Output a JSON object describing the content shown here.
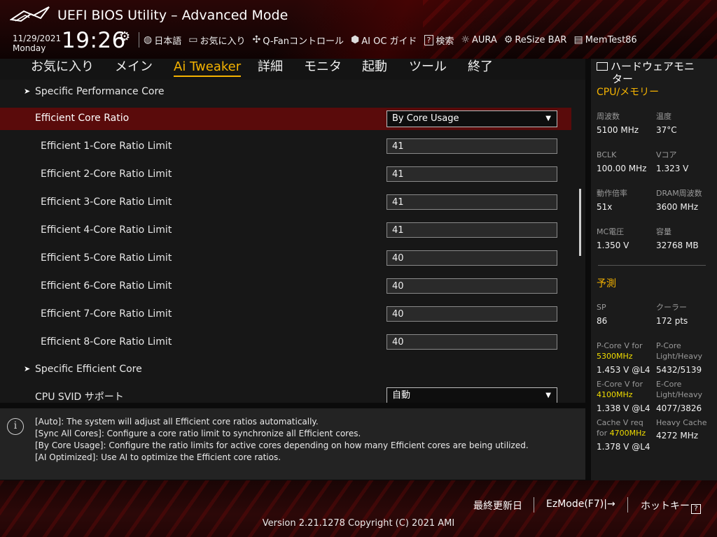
{
  "header": {
    "title": "UEFI BIOS Utility – Advanced Mode",
    "date": "11/29/2021",
    "day": "Monday",
    "time": "19:26",
    "toolbar": [
      {
        "icon": "globe-icon",
        "glyph": "🌐",
        "label": "日本語"
      },
      {
        "icon": "bookmark-icon",
        "glyph": "🗎",
        "label": "お気に入り"
      },
      {
        "icon": "fan-icon",
        "glyph": "✣",
        "label": "Q-Fanコントロール"
      },
      {
        "icon": "ai-oc-icon",
        "glyph": "⛭",
        "label": "AI OC ガイド"
      },
      {
        "icon": "help-icon",
        "glyph": "?",
        "label": "検索"
      },
      {
        "icon": "aura-icon",
        "glyph": "☼",
        "label": "AURA"
      },
      {
        "icon": "resize-bar-icon",
        "glyph": "⚙",
        "label": "ReSize BAR"
      },
      {
        "icon": "memtest-icon",
        "glyph": "▤",
        "label": "MemTest86"
      }
    ]
  },
  "nav": {
    "tabs": [
      "お気に入り",
      "メイン",
      "Ai Tweaker",
      "詳細",
      "モニタ",
      "起動",
      "ツール",
      "終了"
    ],
    "active": "Ai Tweaker"
  },
  "settings": {
    "specific_performance_core": "Specific Performance Core",
    "efficient_core_ratio": {
      "label": "Efficient Core Ratio",
      "value": "By Core Usage"
    },
    "limits": [
      {
        "label": "Efficient 1-Core Ratio Limit",
        "value": "41"
      },
      {
        "label": "Efficient 2-Core Ratio Limit",
        "value": "41"
      },
      {
        "label": "Efficient 3-Core Ratio Limit",
        "value": "41"
      },
      {
        "label": "Efficient 4-Core Ratio Limit",
        "value": "41"
      },
      {
        "label": "Efficient 5-Core Ratio Limit",
        "value": "40"
      },
      {
        "label": "Efficient 6-Core Ratio Limit",
        "value": "40"
      },
      {
        "label": "Efficient 7-Core Ratio Limit",
        "value": "40"
      },
      {
        "label": "Efficient 8-Core Ratio Limit",
        "value": "40"
      }
    ],
    "specific_efficient_core": "Specific Efficient Core",
    "cpu_svid": {
      "label": "CPU SVID サポート",
      "value": "自動"
    }
  },
  "help": {
    "lines": [
      "[Auto]: The system will adjust all Efficient core ratios automatically.",
      "[Sync All Cores]: Configure a core ratio limit to synchronize all Efficient cores.",
      "[By Core Usage]: Configure the ratio limits for active cores depending on how many Efficient cores are being utilized.",
      "[AI Optimized]: Use AI to optimize the Efficient core ratios."
    ]
  },
  "monitor": {
    "title_line1": "ハードウェアモニ",
    "title_line2": "ター",
    "section_cpu": "CPU/メモリー",
    "freq_label": "周波数",
    "freq_value": "5100 MHz",
    "temp_label": "温度",
    "temp_value": "37°C",
    "bclk_label": "BCLK",
    "bclk_value": "100.00 MHz",
    "vcore_label": "Vコア",
    "vcore_value": "1.323 V",
    "ratio_label": "動作倍率",
    "ratio_value": "51x",
    "dram_label": "DRAM周波数",
    "dram_value": "3600 MHz",
    "mc_label": "MC電圧",
    "mc_value": "1.350 V",
    "cap_label": "容量",
    "cap_value": "32768 MB",
    "section_pred": "予測",
    "sp_label": "SP",
    "sp_value": "86",
    "cooler_label": "クーラー",
    "cooler_value": "172 pts",
    "pcore_v_label": "P-Core V for",
    "pcore_v_freq": "5300MHz",
    "pcore_v_value": "1.453 V @L4",
    "pcore_lh_label1": "P-Core",
    "pcore_lh_label2": "Light/Heavy",
    "pcore_lh_value": "5432/5139",
    "ecore_v_label": "E-Core V for",
    "ecore_v_freq": "4100MHz",
    "ecore_v_value": "1.338 V @L4",
    "ecore_lh_label1": "E-Core",
    "ecore_lh_label2": "Light/Heavy",
    "ecore_lh_value": "4077/3826",
    "cache_label1": "Cache V req",
    "cache_label2_prefix": "for ",
    "cache_freq": "4700MHz",
    "cache_value": "1.378 V @L4",
    "heavy_cache_label": "Heavy Cache",
    "heavy_cache_value": "4272 MHz"
  },
  "footer": {
    "last_modified": "最終更新日",
    "ezmode": "EzMode(F7)|",
    "hotkeys": "ホットキー",
    "hotkey_glyph": "?",
    "version": "Version 2.21.1278 Copyright (C) 2021 AMI"
  },
  "colors": {
    "accent": "#f5b301",
    "highlight": "#f0dc00",
    "selected_row": "#5a0b0b"
  }
}
